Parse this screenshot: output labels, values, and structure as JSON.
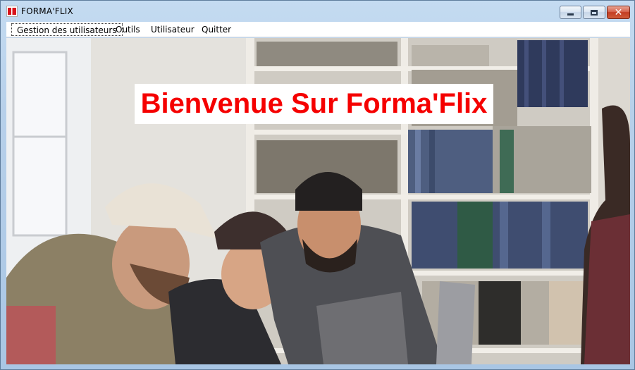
{
  "window": {
    "title": "FORMA'FLIX",
    "icon": "formaflix-app-icon",
    "controls": {
      "minimize": "minimize-icon",
      "maximize": "maximize-icon",
      "close": "close-icon",
      "close_glyph": "✕"
    }
  },
  "menu": {
    "items": [
      {
        "label": "Gestion des utilisateurs"
      },
      {
        "label": "Outils"
      },
      {
        "label": "Utilisateur"
      },
      {
        "label": "Quitter"
      }
    ]
  },
  "main": {
    "welcome_text": "Bienvenue Sur Forma'Flix",
    "welcome_color": "#f50000",
    "background_image": "photo: group of people laughing around laptops in front of bookshelves"
  }
}
